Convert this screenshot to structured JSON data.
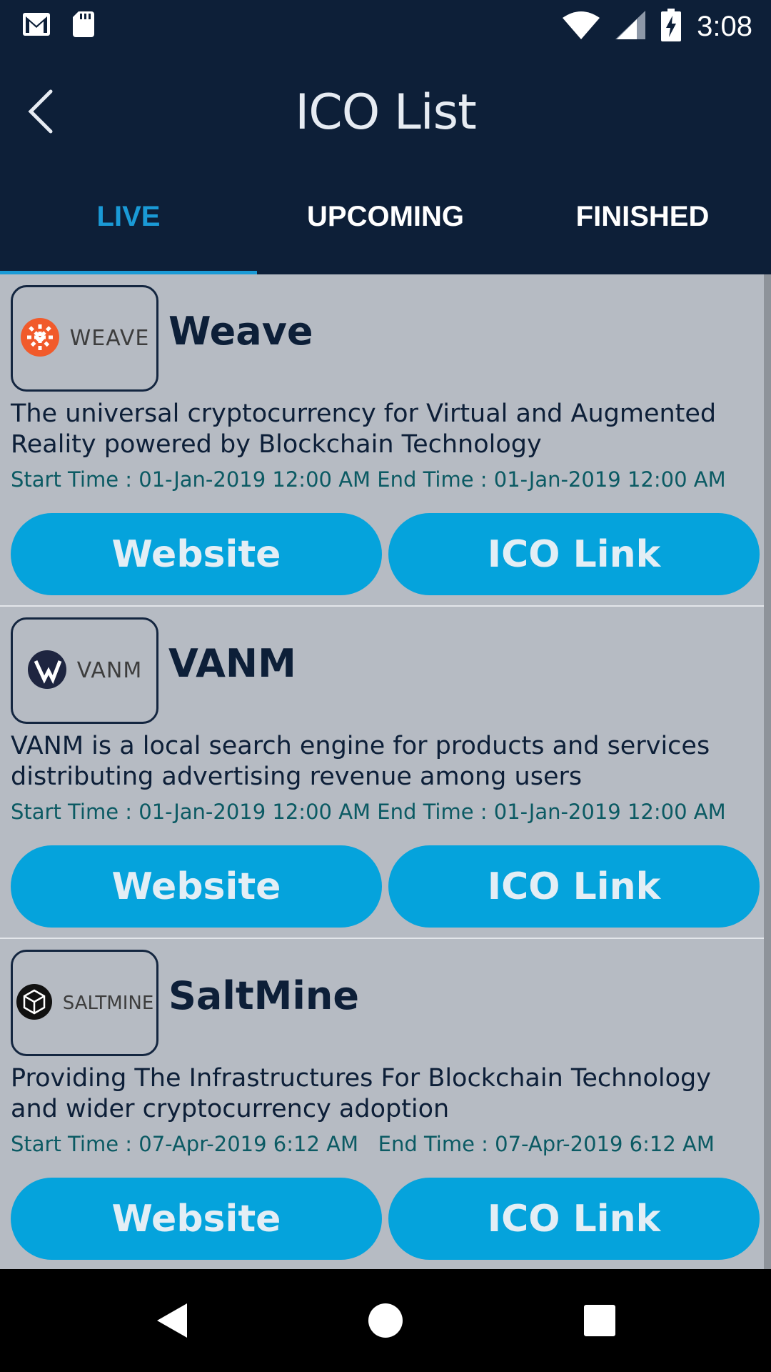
{
  "status_bar": {
    "time": "3:08",
    "icons": [
      "gmail-icon",
      "sd-card-icon",
      "wifi-icon",
      "signal-icon",
      "battery-charging-icon"
    ]
  },
  "app_bar": {
    "title": "ICO List",
    "back_icon": "back-chevron-icon"
  },
  "tabs": [
    {
      "label": "LIVE",
      "active": true
    },
    {
      "label": "UPCOMING",
      "active": false
    },
    {
      "label": "FINISHED",
      "active": false
    }
  ],
  "colors": {
    "header": "#0d1f38",
    "accent": "#1a9ad6",
    "button": "#05a3dc",
    "list_bg": "#b6bbc3",
    "time_text": "#0b5a63"
  },
  "items": [
    {
      "logo_text": "WEAVE",
      "name": "Weave",
      "description": "The universal cryptocurrency for Virtual and Augmented Reality powered by Blockchain Technology",
      "time": "Start Time : 01-Jan-2019 12:00 AM End Time : 01-Jan-2019 12:00 AM",
      "website_label": "Website",
      "ico_label": "ICO Link"
    },
    {
      "logo_text": "VANM",
      "name": "VANM",
      "description": "VANM is a local search engine for products and services distributing advertising revenue among users",
      "time": "Start Time : 01-Jan-2019 12:00 AM End Time : 01-Jan-2019 12:00 AM",
      "website_label": "Website",
      "ico_label": "ICO Link"
    },
    {
      "logo_text": "SALTMINE",
      "name": "SaltMine",
      "description": "Providing The Infrastructures For Blockchain Technology and wider cryptocurrency adoption",
      "time": "Start Time : 07-Apr-2019 6:12 AM   End Time : 07-Apr-2019 6:12 AM",
      "website_label": "Website",
      "ico_label": "ICO Link"
    }
  ],
  "nav_bar": {
    "icons": [
      "nav-back-icon",
      "nav-home-icon",
      "nav-recents-icon"
    ]
  }
}
